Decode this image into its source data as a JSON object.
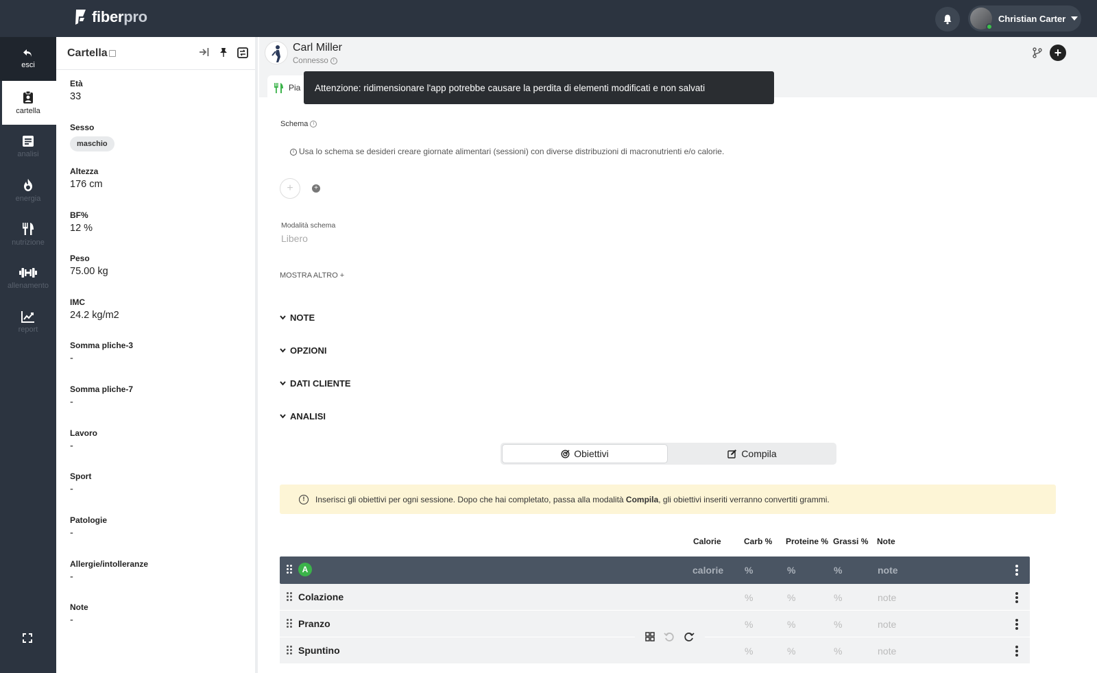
{
  "app": {
    "logo_main": "fiber",
    "logo_accent": "pro"
  },
  "header": {
    "user_name": "Christian Carter"
  },
  "nav": {
    "items": [
      {
        "label": "esci",
        "icon": "undo-arrow-icon"
      },
      {
        "label": "cartella",
        "icon": "clipboard-user-icon"
      },
      {
        "label": "analisi",
        "icon": "document-list-icon"
      },
      {
        "label": "energia",
        "icon": "flame-icon"
      },
      {
        "label": "nutrizione",
        "icon": "fork-knife-icon"
      },
      {
        "label": "allenamento",
        "icon": "dumbbell-icon"
      },
      {
        "label": "report",
        "icon": "chart-line-icon"
      }
    ]
  },
  "cartella": {
    "title": "Cartella",
    "fields": [
      {
        "key": "Età",
        "value": "33"
      },
      {
        "key": "Sesso",
        "value": "maschio"
      },
      {
        "key": "Altezza",
        "value": "176 cm"
      },
      {
        "key": "BF%",
        "value": "12 %"
      },
      {
        "key": "Peso",
        "value": "75.00 kg"
      },
      {
        "key": "IMC",
        "value": "24.2 kg/m2"
      },
      {
        "key": "Somma pliche-3",
        "value": "-"
      },
      {
        "key": "Somma pliche-7",
        "value": "-"
      },
      {
        "key": "Lavoro",
        "value": "-"
      },
      {
        "key": "Sport",
        "value": "-"
      },
      {
        "key": "Patologie",
        "value": "-"
      },
      {
        "key": "Allergie/intolleranze",
        "value": "-"
      },
      {
        "key": "Note",
        "value": "-"
      }
    ]
  },
  "client": {
    "name": "Carl Miller",
    "status": "Connesso"
  },
  "tab": {
    "label": "Pia"
  },
  "tooltip": "Attenzione: ridimensionare l'app potrebbe causare la perdita di elementi modificati e non salvati",
  "schema": {
    "label": "Schema",
    "hint": "Usa lo schema se desideri creare giornate alimentari (sessioni) con diverse distribuzioni di macronutrienti e/o calorie.",
    "mode_label": "Modalità schema",
    "mode_value": "Libero",
    "show_more": "MOSTRA ALTRO +"
  },
  "sections": [
    "NOTE",
    "OPZIONI",
    "DATI CLIENTE",
    "ANALISI"
  ],
  "toggle": {
    "objectives": "Obiettivi",
    "fill": "Compila"
  },
  "alert": {
    "before": "Inserisci gli obiettivi per ogni sessione. Dopo che hai completato, passa alla modalità ",
    "bold": "Compila",
    "after": ", gli obiettivi inseriti verranno convertiti grammi."
  },
  "table": {
    "columns": [
      "Calorie",
      "Carb %",
      "Proteine %",
      "Grassi %",
      "Note"
    ],
    "session": {
      "badge": "A",
      "calorie": "calorie",
      "carb": "%",
      "protein": "%",
      "fat": "%",
      "note": "note"
    },
    "meals": [
      {
        "name": "Colazione",
        "carb": "%",
        "protein": "%",
        "fat": "%",
        "note": "note"
      },
      {
        "name": "Pranzo",
        "carb": "%",
        "protein": "%",
        "fat": "%",
        "note": "note"
      },
      {
        "name": "Spuntino",
        "carb": "%",
        "protein": "%",
        "fat": "%",
        "note": "note"
      }
    ]
  },
  "colors": {
    "topbar": "#2c3440",
    "session_row": "#4a5563",
    "alert_bg": "#fdf5d6",
    "badge_green": "#3bb34a"
  }
}
